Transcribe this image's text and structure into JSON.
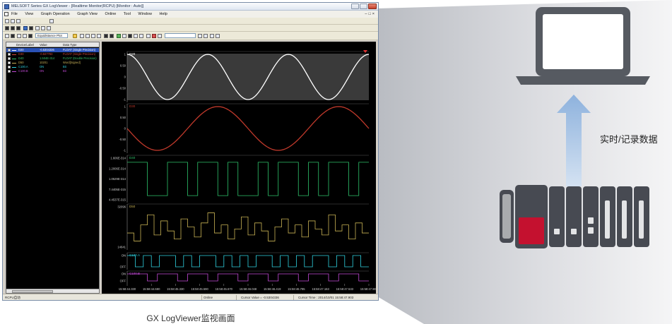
{
  "window": {
    "title": "MELSOFT Series GX LogViewer - [Realtime Monitor(RCPU) [Monitor : Auto]]"
  },
  "menu": [
    "File",
    "View",
    "Graph Operation",
    "Graph View",
    "Online",
    "Tool",
    "Window",
    "Help"
  ],
  "toolbar": {
    "plot_mode": "Equidistance Plot"
  },
  "device_table": {
    "headers": [
      "Device/Label",
      "Value",
      "Data Type"
    ],
    "rows": [
      {
        "device": "D20",
        "value": "-0.5304336",
        "type": "FLOAT (Single Precision)",
        "color": "#ffffff",
        "selected": true
      },
      {
        "device": "D30",
        "value": "-0.847783",
        "type": "FLOAT (Single Precision)",
        "color": "#d14a3c",
        "selected": false
      },
      {
        "device": "D40",
        "value": "1.504E-314",
        "type": "FLOAT (Double Precision)",
        "color": "#33c26a",
        "selected": false
      },
      {
        "device": "D50",
        "value": "10201",
        "type": "Word[Signed]",
        "color": "#c9b25a",
        "selected": false
      },
      {
        "device": "C100.A",
        "value": "ON",
        "type": "Bit",
        "color": "#2fd2e0",
        "selected": false
      },
      {
        "device": "C100.B",
        "value": "ON",
        "type": "Bit",
        "color": "#c24ad6",
        "selected": false
      }
    ]
  },
  "chart_data": {
    "type": "line",
    "title": "",
    "xlabel": "",
    "ylabel": "",
    "x_ticks": [
      "15:58:44.330",
      "15:58:44.680",
      "15:58:45.330",
      "15:58:45.590",
      "15:58:45.670",
      "15:58:46.048",
      "15:58:46.419",
      "15:58:46.785",
      "15:58:47.163",
      "15:58:47.533",
      "15:58:47.903"
    ],
    "series": [
      {
        "name": "D20",
        "kind": "sine",
        "color": "#ffffff",
        "ylim": [
          -1,
          1
        ],
        "y_ticks": [
          "1",
          "0.50",
          "0",
          "-0.50",
          "-1"
        ],
        "cycles": 3,
        "phase": 0.0
      },
      {
        "name": "D30",
        "kind": "sine",
        "color": "#c0392b",
        "ylim": [
          -1,
          1
        ],
        "y_ticks": [
          "1",
          "0.50",
          "0",
          "-0.50",
          "-1"
        ],
        "cycles": 2,
        "phase": 0.25
      },
      {
        "name": "D40",
        "kind": "step",
        "color": "#2ec46b",
        "ylim": [
          0,
          2e-314
        ],
        "y_ticks": [
          "1.606E-314",
          "1.2006E-314",
          "1.0529E-314",
          "7.4405E-315",
          "4.4537E-315"
        ],
        "values": [
          0.9,
          0.9,
          0.1,
          0.1,
          0.9,
          0.9,
          0.1,
          0.9,
          0.9,
          0.1,
          0.9,
          0.1,
          0.1,
          0.9,
          0.1,
          0.9,
          0.9,
          0.1,
          0.9,
          0.1,
          0.9,
          0.9,
          0.1,
          0.9
        ]
      },
      {
        "name": "D50",
        "kind": "step",
        "color": "#c8b254",
        "ylim": [
          0,
          32000
        ],
        "y_ticks": [
          "32096",
          "14641"
        ],
        "values": [
          0.35,
          0.15,
          0.55,
          0.8,
          0.3,
          0.65,
          0.4,
          0.2,
          0.7,
          0.5,
          0.25,
          0.6,
          0.85,
          0.35,
          0.55,
          0.2,
          0.45,
          0.75,
          0.3,
          0.6,
          0.4,
          0.15,
          0.5,
          0.7,
          0.35,
          0.55,
          0.25,
          0.65,
          0.45,
          0.3,
          0.8,
          0.4,
          0.55,
          0.2,
          0.6,
          0.35
        ]
      },
      {
        "name": "C100.A",
        "kind": "bit",
        "color": "#2fd2e0",
        "y_ticks": [
          "ON",
          "OFF"
        ],
        "values": [
          1,
          0,
          1,
          0,
          1,
          1,
          0,
          1,
          0,
          1,
          1,
          0,
          1,
          0,
          1,
          0,
          1,
          1,
          0,
          1,
          0,
          1,
          0,
          1,
          1,
          0,
          1,
          0,
          1,
          0
        ]
      },
      {
        "name": "C100.B",
        "kind": "bit",
        "color": "#c24ad6",
        "y_ticks": [
          "ON",
          "OFF"
        ],
        "values": [
          1,
          1,
          0,
          1,
          1,
          0,
          1,
          1,
          0,
          1,
          1,
          0,
          1,
          1,
          0,
          1,
          1,
          0,
          1,
          1,
          0,
          1,
          1,
          0
        ]
      }
    ]
  },
  "statusbar": {
    "left": "RCPU自动",
    "mode": "Online",
    "cursor_value": "Cursor Value = -0.5304336",
    "cursor_time": "Cursor Time : 2014/10/01 15:58:47.903"
  },
  "caption": "GX LogViewer监视画面",
  "data_label": "实时/记录数据",
  "colors": {
    "arrow": "#8eb2dd",
    "laptop": "#565a61",
    "plc_body": "#474a52",
    "plc_red": "#c4112f"
  }
}
